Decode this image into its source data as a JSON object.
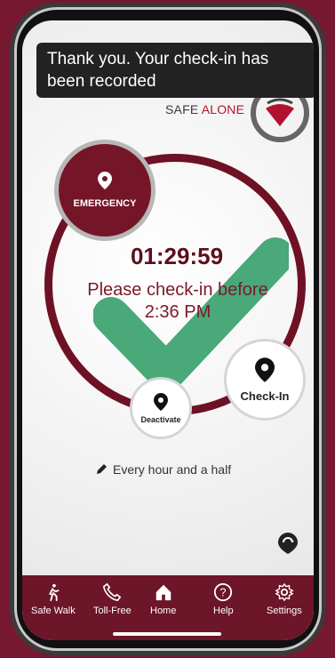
{
  "toast": {
    "message": "Thank you.  Your check-in has been recorded"
  },
  "brand": {
    "part1": "SAFE ",
    "part2": "ALONE"
  },
  "emergency": {
    "label": "EMERGENCY"
  },
  "timer": {
    "value": "01:29:59",
    "message": "Please check-in before 2:36 PM"
  },
  "buttons": {
    "checkin": "Check-In",
    "deactivate": "Deactivate"
  },
  "interval": {
    "label": "Every hour and a half"
  },
  "nav": {
    "items": [
      {
        "label": "Safe Walk",
        "icon": "walking-person-icon"
      },
      {
        "label": "Toll-Free",
        "icon": "phone-icon"
      },
      {
        "label": "Home",
        "icon": "home-icon"
      },
      {
        "label": "Help",
        "icon": "help-icon"
      },
      {
        "label": "Settings",
        "icon": "gear-icon"
      }
    ]
  },
  "colors": {
    "background": "#761830",
    "accent": "#6d1529",
    "check": "#35a06a"
  }
}
